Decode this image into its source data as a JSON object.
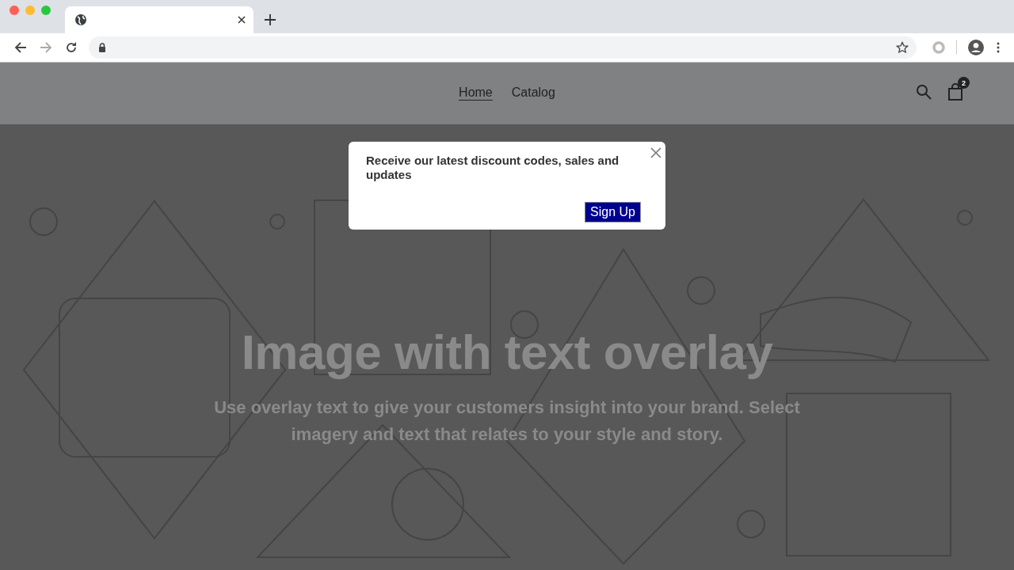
{
  "store_header": {
    "nav": [
      {
        "label": "Home",
        "selected": true
      },
      {
        "label": "Catalog",
        "selected": false
      }
    ],
    "cart_count": "2"
  },
  "hero": {
    "kind": "picture",
    "title": "Image with text overlay",
    "text": "Use overlay text to give your customers insight into your brand. Select imagery and text that relates to your style and story."
  },
  "popup": {
    "message": "Receive our latest discount codes, sales and updates",
    "button": "Sign Up"
  }
}
